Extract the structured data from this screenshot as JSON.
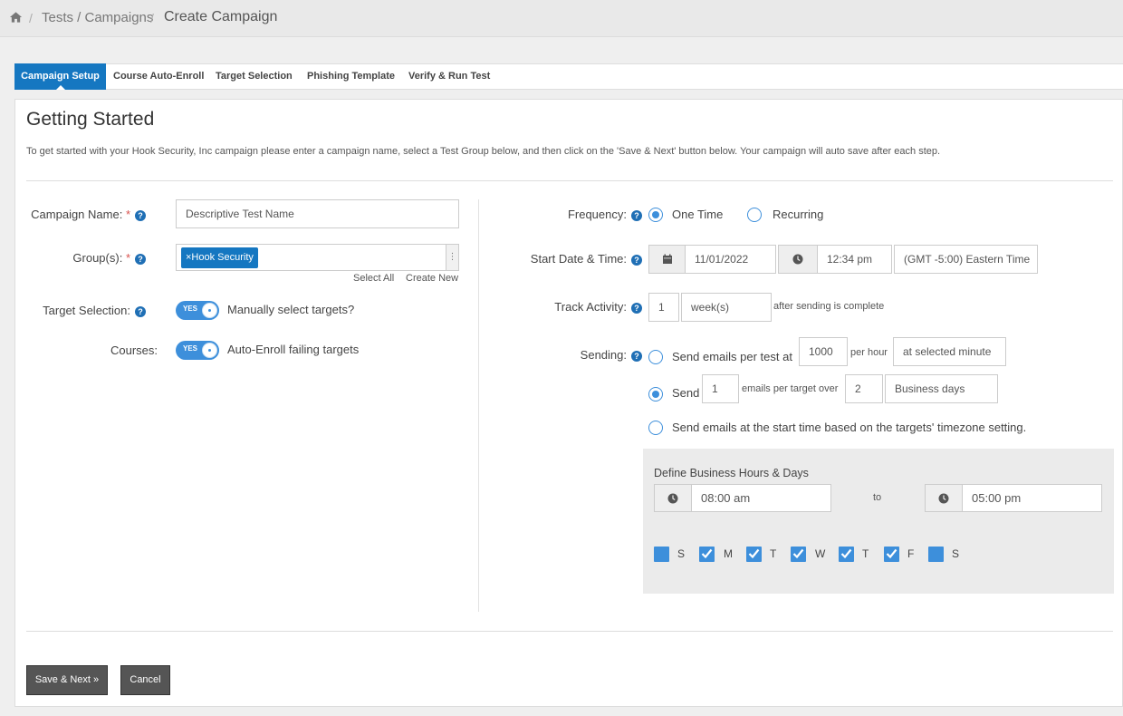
{
  "breadcrumb": {
    "sep": "/",
    "parent": "Tests / Campaigns",
    "current": "Create Campaign"
  },
  "tabs": [
    {
      "label": "Campaign Setup",
      "active": true
    },
    {
      "label": "Course Auto-Enroll",
      "active": false
    },
    {
      "label": "Target Selection",
      "active": false
    },
    {
      "label": "Phishing Template",
      "active": false
    },
    {
      "label": "Verify & Run Test",
      "active": false
    }
  ],
  "page": {
    "title": "Getting Started",
    "intro": "To get started with your Hook Security, Inc campaign please enter a campaign name, select a Test Group below, and then click on the 'Save & Next' button below. Your campaign will auto save after each step."
  },
  "form": {
    "required_mark": "*",
    "help_glyph": "?",
    "campaign_name": {
      "label": "Campaign Name:",
      "placeholder": "Descriptive Test Name"
    },
    "groups": {
      "label": "Group(s):",
      "tag": "×Hook Security",
      "select_all": "Select All",
      "create_new": "Create New",
      "grip": "⋮"
    },
    "target_selection": {
      "label": "Target Selection:",
      "toggle": "YES",
      "text": "Manually select targets?"
    },
    "courses": {
      "label": "Courses:",
      "toggle": "YES",
      "text": "Auto-Enroll failing targets"
    },
    "frequency": {
      "label": "Frequency:",
      "one_time": "One Time",
      "recurring": "Recurring",
      "selected": "One Time"
    },
    "start": {
      "label": "Start Date & Time:",
      "date": "11/01/2022",
      "time": "12:34 pm",
      "timezone": "(GMT -5:00) Eastern Time"
    },
    "track": {
      "label": "Track Activity:",
      "amount": "1",
      "unit": "week(s)",
      "suffix": "after sending is complete"
    },
    "sending": {
      "label": "Sending:",
      "opt1_text": "Send emails per test at",
      "opt1_amount": "1000",
      "opt1_per": "per hour",
      "opt1_when": "at selected minute",
      "opt2_text": "Send",
      "opt2_amount": "1",
      "opt2_mid": "emails per target over",
      "opt2_days": "2",
      "opt2_unit": "Business days",
      "opt3_text": "Send emails at the start time based on the targets' timezone setting.",
      "selected": 2
    },
    "business": {
      "title": "Define Business Hours & Days",
      "from": "08:00 am",
      "to_label": "to",
      "to": "05:00 pm",
      "days": [
        {
          "label": "S",
          "checked": false
        },
        {
          "label": "M",
          "checked": true
        },
        {
          "label": "T",
          "checked": true
        },
        {
          "label": "W",
          "checked": true
        },
        {
          "label": "T",
          "checked": true
        },
        {
          "label": "F",
          "checked": true
        },
        {
          "label": "S",
          "checked": false
        }
      ]
    }
  },
  "buttons": {
    "save": "Save & Next »",
    "cancel": "Cancel"
  },
  "colors": {
    "accent": "#1577c1",
    "toggle": "#3d8fdb",
    "required": "#d9534f",
    "button": "#555555"
  }
}
